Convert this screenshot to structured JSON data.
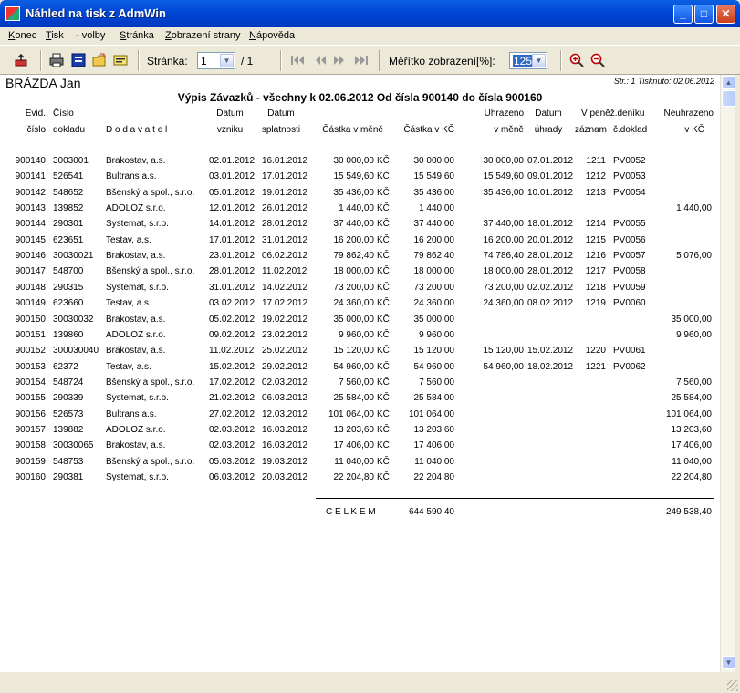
{
  "window": {
    "title": "Náhled na tisk z AdmWin"
  },
  "menu": [
    {
      "u": "K",
      "rest": "onec"
    },
    {
      "u": "T",
      "rest": "isk"
    },
    {
      "u": "",
      "rest": " - volby"
    },
    {
      "u": "S",
      "rest": "tránka"
    },
    {
      "u": "Z",
      "rest": "obrazení strany"
    },
    {
      "u": "N",
      "rest": "ápověda"
    }
  ],
  "toolbar": {
    "page_label": "Stránka:",
    "page_value": "1",
    "page_total": "/ 1",
    "zoom_label": "Měřítko zobrazení[%]:",
    "zoom_value": "125"
  },
  "report": {
    "author": "BRÁZDA Jan",
    "page_info": "Str.: 1   Tisknuto: 02.06.2012",
    "title": "Výpis Závazků - všechny k 02.06.2012 Od čísla 900140 do čísla 900160",
    "headers": {
      "evid1": "Evid.",
      "evid2": "číslo",
      "cislo1": "Číslo",
      "cislo2": "dokladu",
      "dodavatel": "D o d a v a t e l",
      "datvz1": "Datum",
      "datvz2": "vzniku",
      "datspl1": "Datum",
      "datspl2": "splatnosti",
      "castka_mene": "Částka v měně",
      "castka_kc": "Částka v KČ",
      "uhr1": "Uhrazeno",
      "uhr2": "v měně",
      "datuhr1": "Datum",
      "datuhr2": "úhrady",
      "pd1": "V peněž.deníku",
      "pd_zaznam": "záznam",
      "pd_doklad": "č.doklad",
      "neuhr1": "Neuhrazeno",
      "neuhr2": "v KČ"
    },
    "rows": [
      [
        "900140",
        "3003001",
        "Brakostav, a.s.",
        "02.01.2012",
        "16.01.2012",
        "30 000,00",
        "KČ",
        "30 000,00",
        "30 000,00",
        "07.01.2012",
        "1211",
        "PV0052",
        ""
      ],
      [
        "900141",
        "526541",
        "Bultrans a.s.",
        "03.01.2012",
        "17.01.2012",
        "15 549,60",
        "KČ",
        "15 549,60",
        "15 549,60",
        "09.01.2012",
        "1212",
        "PV0053",
        ""
      ],
      [
        "900142",
        "548652",
        "Bšenský a spol., s.r.o.",
        "05.01.2012",
        "19.01.2012",
        "35 436,00",
        "KČ",
        "35 436,00",
        "35 436,00",
        "10.01.2012",
        "1213",
        "PV0054",
        ""
      ],
      [
        "900143",
        "139852",
        "ADOLOZ s.r.o.",
        "12.01.2012",
        "26.01.2012",
        "1 440,00",
        "KČ",
        "1 440,00",
        "",
        "",
        "",
        "",
        "1 440,00"
      ],
      [
        "900144",
        "290301",
        "Systemat, s.r.o.",
        "14.01.2012",
        "28.01.2012",
        "37 440,00",
        "KČ",
        "37 440,00",
        "37 440,00",
        "18.01.2012",
        "1214",
        "PV0055",
        ""
      ],
      [
        "900145",
        "623651",
        "Testav, a.s.",
        "17.01.2012",
        "31.01.2012",
        "16 200,00",
        "KČ",
        "16 200,00",
        "16 200,00",
        "20.01.2012",
        "1215",
        "PV0056",
        ""
      ],
      [
        "900146",
        "30030021",
        "Brakostav, a.s.",
        "23.01.2012",
        "06.02.2012",
        "79 862,40",
        "KČ",
        "79 862,40",
        "74 786,40",
        "28.01.2012",
        "1216",
        "PV0057",
        "5 076,00"
      ],
      [
        "900147",
        "548700",
        "Bšenský a spol., s.r.o.",
        "28.01.2012",
        "11.02.2012",
        "18 000,00",
        "KČ",
        "18 000,00",
        "18 000,00",
        "28.01.2012",
        "1217",
        "PV0058",
        ""
      ],
      [
        "900148",
        "290315",
        "Systemat, s.r.o.",
        "31.01.2012",
        "14.02.2012",
        "73 200,00",
        "KČ",
        "73 200,00",
        "73 200,00",
        "02.02.2012",
        "1218",
        "PV0059",
        ""
      ],
      [
        "900149",
        "623660",
        "Testav, a.s.",
        "03.02.2012",
        "17.02.2012",
        "24 360,00",
        "KČ",
        "24 360,00",
        "24 360,00",
        "08.02.2012",
        "1219",
        "PV0060",
        ""
      ],
      [
        "900150",
        "30030032",
        "Brakostav, a.s.",
        "05.02.2012",
        "19.02.2012",
        "35 000,00",
        "KČ",
        "35 000,00",
        "",
        "",
        "",
        "",
        "35 000,00"
      ],
      [
        "900151",
        "139860",
        "ADOLOZ s.r.o.",
        "09.02.2012",
        "23.02.2012",
        "9 960,00",
        "KČ",
        "9 960,00",
        "",
        "",
        "",
        "",
        "9 960,00"
      ],
      [
        "900152",
        "300030040",
        "Brakostav, a.s.",
        "11.02.2012",
        "25.02.2012",
        "15 120,00",
        "KČ",
        "15 120,00",
        "15 120,00",
        "15.02.2012",
        "1220",
        "PV0061",
        ""
      ],
      [
        "900153",
        "62372",
        "Testav, a.s.",
        "15.02.2012",
        "29.02.2012",
        "54 960,00",
        "KČ",
        "54 960,00",
        "54 960,00",
        "18.02.2012",
        "1221",
        "PV0062",
        ""
      ],
      [
        "900154",
        "548724",
        "Bšenský a spol., s.r.o.",
        "17.02.2012",
        "02.03.2012",
        "7 560,00",
        "KČ",
        "7 560,00",
        "",
        "",
        "",
        "",
        "7 560,00"
      ],
      [
        "900155",
        "290339",
        "Systemat, s.r.o.",
        "21.02.2012",
        "06.03.2012",
        "25 584,00",
        "KČ",
        "25 584,00",
        "",
        "",
        "",
        "",
        "25 584,00"
      ],
      [
        "900156",
        "526573",
        "Bultrans a.s.",
        "27.02.2012",
        "12.03.2012",
        "101 064,00",
        "KČ",
        "101 064,00",
        "",
        "",
        "",
        "",
        "101 064,00"
      ],
      [
        "900157",
        "139882",
        "ADOLOZ s.r.o.",
        "02.03.2012",
        "16.03.2012",
        "13 203,60",
        "KČ",
        "13 203,60",
        "",
        "",
        "",
        "",
        "13 203,60"
      ],
      [
        "900158",
        "30030065",
        "Brakostav, a.s.",
        "02.03.2012",
        "16.03.2012",
        "17 406,00",
        "KČ",
        "17 406,00",
        "",
        "",
        "",
        "",
        "17 406,00"
      ],
      [
        "900159",
        "548753",
        "Bšenský a spol., s.r.o.",
        "05.03.2012",
        "19.03.2012",
        "11 040,00",
        "KČ",
        "11 040,00",
        "",
        "",
        "",
        "",
        "11 040,00"
      ],
      [
        "900160",
        "290381",
        "Systemat, s.r.o.",
        "06.03.2012",
        "20.03.2012",
        "22 204,80",
        "KČ",
        "22 204,80",
        "",
        "",
        "",
        "",
        "22 204,80"
      ]
    ],
    "total": {
      "label": "C E L K E M",
      "castka_kc": "644 590,40",
      "neuhrazeno": "249 538,40"
    }
  },
  "icons": [
    "exit-icon",
    "print-icon",
    "print-setup-icon",
    "open-folder-icon",
    "export-icon",
    "first-page-icon",
    "prev-page-icon",
    "next-page-icon",
    "last-page-icon",
    "zoom-in-icon",
    "zoom-out-icon"
  ]
}
